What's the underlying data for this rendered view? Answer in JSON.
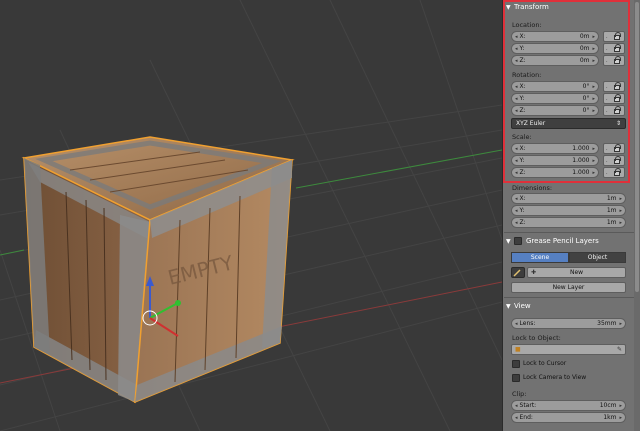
{
  "transform": {
    "title": "Transform",
    "location_label": "Location:",
    "location": [
      {
        "axis": "X:",
        "value": "0m"
      },
      {
        "axis": "Y:",
        "value": "0m"
      },
      {
        "axis": "Z:",
        "value": "0m"
      }
    ],
    "rotation_label": "Rotation:",
    "rotation": [
      {
        "axis": "X:",
        "value": "0°"
      },
      {
        "axis": "Y:",
        "value": "0°"
      },
      {
        "axis": "Z:",
        "value": "0°"
      }
    ],
    "rotation_mode": "XYZ Euler",
    "scale_label": "Scale:",
    "scale": [
      {
        "axis": "X:",
        "value": "1.000"
      },
      {
        "axis": "Y:",
        "value": "1.000"
      },
      {
        "axis": "Z:",
        "value": "1.000"
      }
    ],
    "dimensions_label": "Dimensions:",
    "dimensions": [
      {
        "axis": "X:",
        "value": "1m"
      },
      {
        "axis": "Y:",
        "value": "1m"
      },
      {
        "axis": "Z:",
        "value": "1m"
      }
    ]
  },
  "grease_pencil": {
    "title": "Grease Pencil Layers",
    "tab_scene": "Scene",
    "tab_object": "Object",
    "new_label": "New",
    "new_layer_label": "New Layer"
  },
  "view": {
    "title": "View",
    "lens_label": "Lens:",
    "lens_value": "35mm",
    "lock_to_object_label": "Lock to Object:",
    "lock_to_cursor": "Lock to Cursor",
    "lock_camera_to_view": "Lock Camera to View",
    "clip_label": "Clip:",
    "clip_start_label": "Start:",
    "clip_start_value": "10cm",
    "clip_end_label": "End:",
    "clip_end_value": "1km"
  },
  "colors": {
    "highlight": "#e0303a",
    "active_tab": "#5680c2",
    "selection_outline": "#f0a030"
  },
  "crate_text": "EMPTY"
}
